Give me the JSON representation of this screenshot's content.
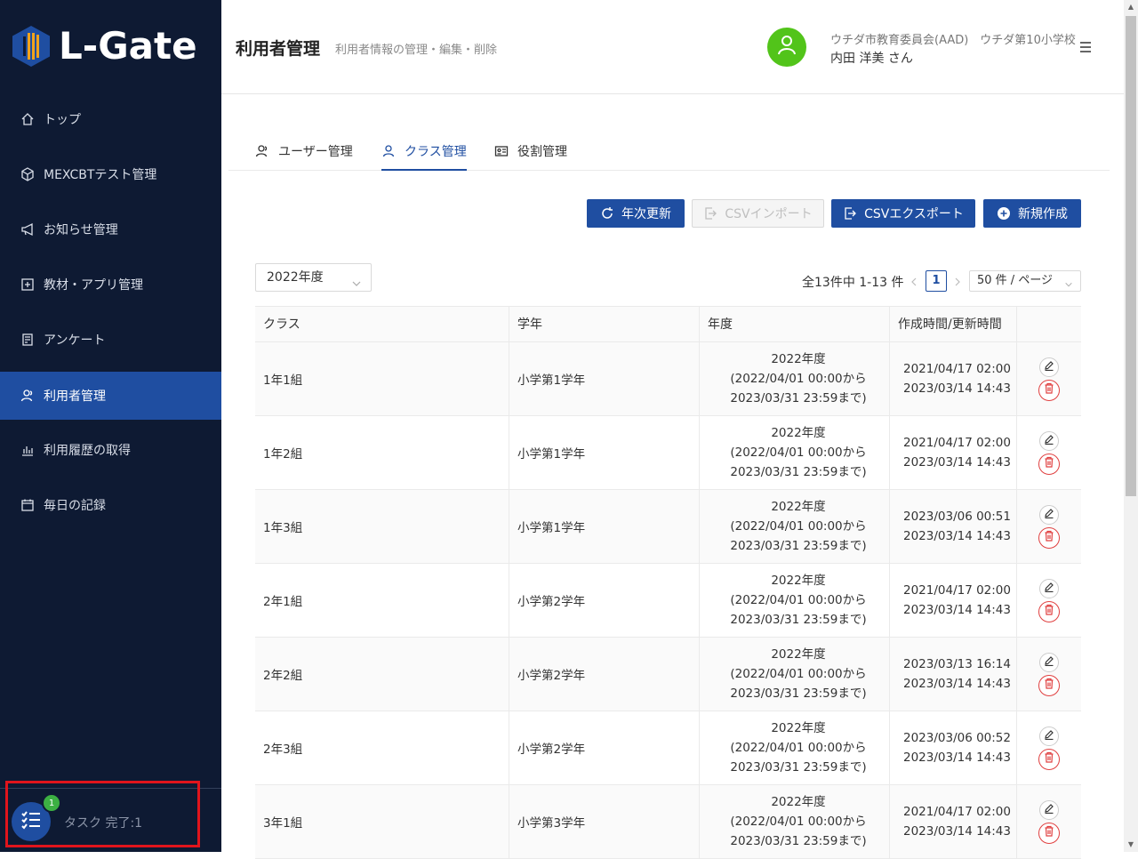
{
  "brand": {
    "name": "L-Gate"
  },
  "sidebar": {
    "items": [
      {
        "label": "トップ",
        "icon": "home-icon"
      },
      {
        "label": "MEXCBTテスト管理",
        "icon": "cube-icon"
      },
      {
        "label": "お知らせ管理",
        "icon": "megaphone-icon"
      },
      {
        "label": "教材・アプリ管理",
        "icon": "plus-square-icon"
      },
      {
        "label": "アンケート",
        "icon": "survey-icon"
      },
      {
        "label": "利用者管理",
        "icon": "users-icon",
        "active": true
      },
      {
        "label": "利用履歴の取得",
        "icon": "bar-chart-icon"
      },
      {
        "label": "毎日の記録",
        "icon": "calendar-icon"
      }
    ],
    "task": {
      "badge": "1",
      "label": "タスク 完了:1"
    }
  },
  "header": {
    "title": "利用者管理",
    "subtitle": "利用者情報の管理・編集・削除",
    "org": "ウチダ市教育委員会(AAD)　ウチダ第10小学校",
    "user": "内田 洋美 さん"
  },
  "tabs": [
    {
      "label": "ユーザー管理",
      "icon": "user-group-icon"
    },
    {
      "label": "クラス管理",
      "icon": "user-icon",
      "active": true
    },
    {
      "label": "役割管理",
      "icon": "id-card-icon"
    }
  ],
  "toolbar": {
    "annual_update": "年次更新",
    "csv_import": "CSVインポート",
    "csv_export": "CSVエクスポート",
    "create_new": "新規作成"
  },
  "filters": {
    "year": "2022年度"
  },
  "pagination": {
    "total": "全13件中 1-13 件",
    "current": "1",
    "page_size": "50 件 / ページ"
  },
  "table": {
    "headers": [
      "クラス",
      "学年",
      "年度",
      "作成時間/更新時間"
    ],
    "rows": [
      {
        "class": "1年1組",
        "grade": "小学第1学年",
        "year1": "2022年度",
        "year2": "(2022/04/01 00:00から",
        "year3": "2023/03/31 23:59まで)",
        "created": "2021/04/17 02:00",
        "updated": "2023/03/14 14:43"
      },
      {
        "class": "1年2組",
        "grade": "小学第1学年",
        "year1": "2022年度",
        "year2": "(2022/04/01 00:00から",
        "year3": "2023/03/31 23:59まで)",
        "created": "2021/04/17 02:00",
        "updated": "2023/03/14 14:43"
      },
      {
        "class": "1年3組",
        "grade": "小学第1学年",
        "year1": "2022年度",
        "year2": "(2022/04/01 00:00から",
        "year3": "2023/03/31 23:59まで)",
        "created": "2023/03/06 00:51",
        "updated": "2023/03/14 14:43"
      },
      {
        "class": "2年1組",
        "grade": "小学第2学年",
        "year1": "2022年度",
        "year2": "(2022/04/01 00:00から",
        "year3": "2023/03/31 23:59まで)",
        "created": "2021/04/17 02:00",
        "updated": "2023/03/14 14:43"
      },
      {
        "class": "2年2組",
        "grade": "小学第2学年",
        "year1": "2022年度",
        "year2": "(2022/04/01 00:00から",
        "year3": "2023/03/31 23:59まで)",
        "created": "2023/03/13 16:14",
        "updated": "2023/03/14 14:43"
      },
      {
        "class": "2年3組",
        "grade": "小学第2学年",
        "year1": "2022年度",
        "year2": "(2022/04/01 00:00から",
        "year3": "2023/03/31 23:59まで)",
        "created": "2023/03/06 00:52",
        "updated": "2023/03/14 14:43"
      },
      {
        "class": "3年1組",
        "grade": "小学第3学年",
        "year1": "2022年度",
        "year2": "(2022/04/01 00:00から",
        "year3": "2023/03/31 23:59まで)",
        "created": "2021/04/17 02:00",
        "updated": "2023/03/14 14:43"
      }
    ]
  }
}
